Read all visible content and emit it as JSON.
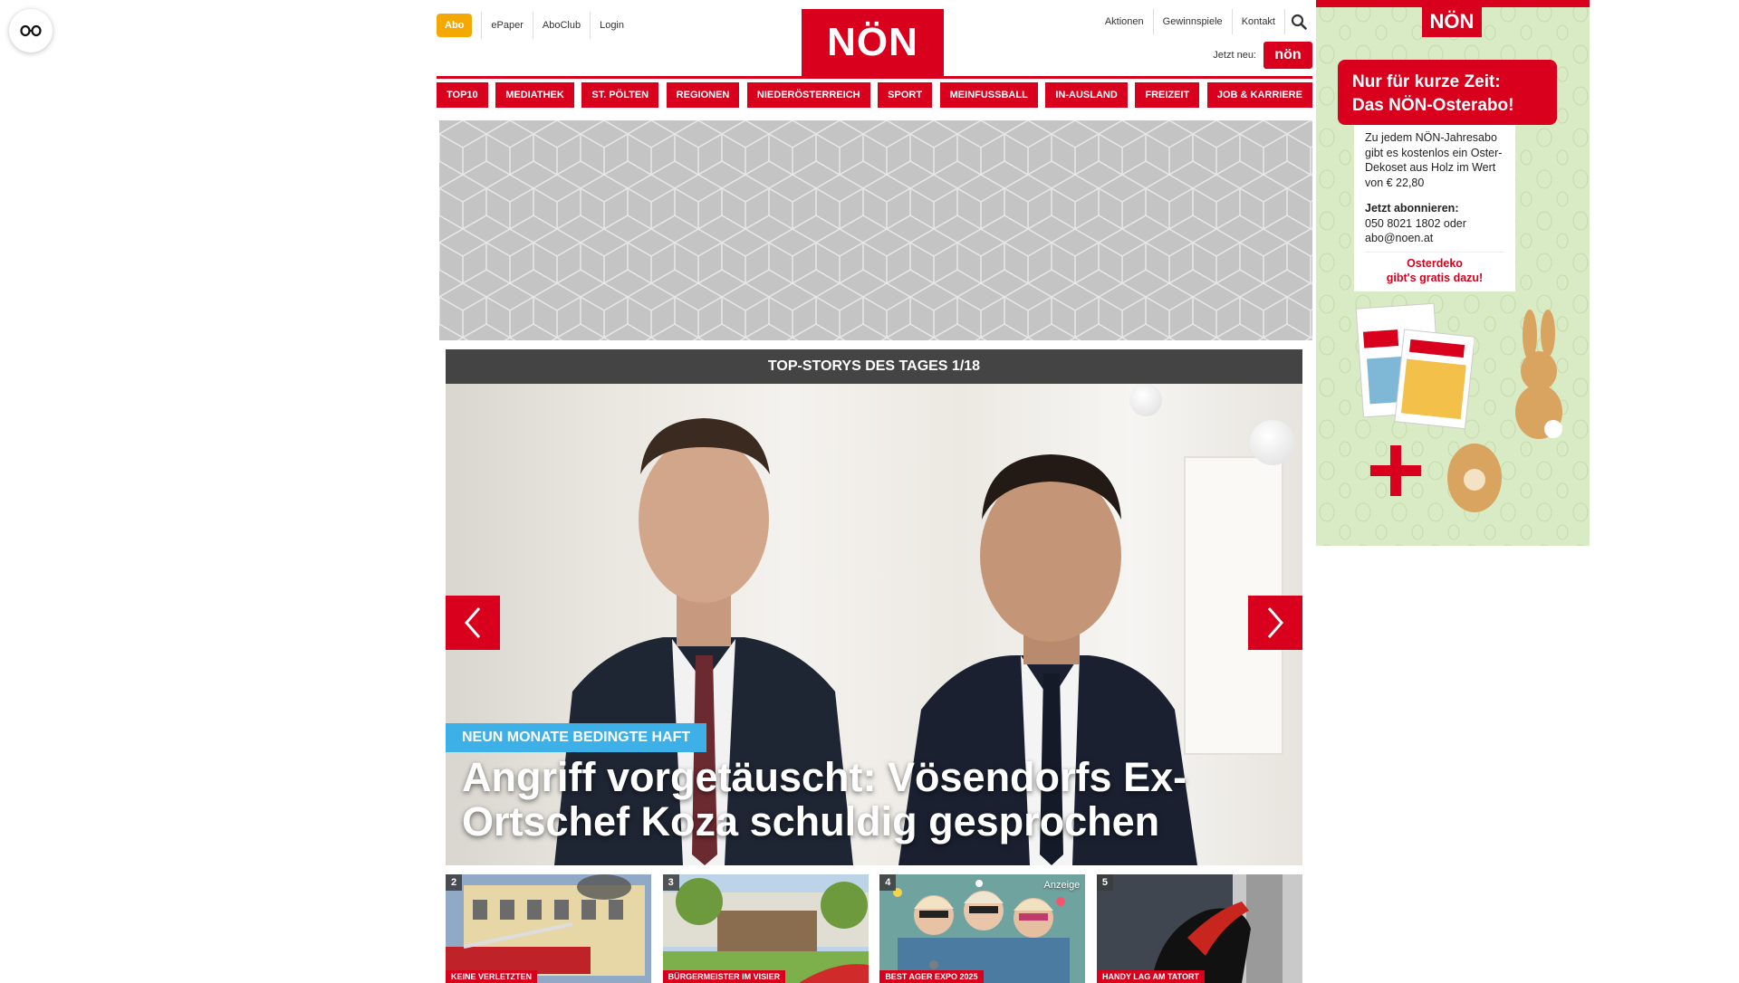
{
  "accessibility": {
    "icon": "glasses-icon"
  },
  "header": {
    "abo_label": "Abo",
    "left_links": [
      "ePaper",
      "AboClub",
      "Login"
    ],
    "logo_text": "NÖN",
    "right_links": [
      "Aktionen",
      "Gewinnspiele",
      "Kontakt"
    ],
    "search_icon": "search-icon",
    "jetzt_label": "Jetzt neu:",
    "jetzt_logo_text": "nön"
  },
  "nav": {
    "items": [
      "TOP10",
      "MEDIATHEK",
      "ST. PÖLTEN",
      "REGIONEN",
      "NIEDERÖSTERREICH",
      "SPORT",
      "MEINFUSSBALL",
      "IN-AUSLAND",
      "FREIZEIT",
      "JOB & KARRIERE"
    ]
  },
  "stories": {
    "heading": "TOP-STORYS DES TAGES 1/18",
    "hero": {
      "badge": "NEUN MONATE BEDINGTE HAFT",
      "title": "Angriff vorgetäuscht: Vösendorfs Ex-Ortschef Koza schuldig gesprochen"
    },
    "thumbs": [
      {
        "num": "2",
        "category": "KEINE VERLETZTEN",
        "ad": ""
      },
      {
        "num": "3",
        "category": "BÜRGERMEISTER IM VISIER",
        "ad": ""
      },
      {
        "num": "4",
        "category": "BEST AGER EXPO 2025",
        "ad": "Anzeige"
      },
      {
        "num": "5",
        "category": "HANDY LAG AM TATORT",
        "ad": ""
      }
    ]
  },
  "sidebar_ad": {
    "logo_text": "NÖN",
    "headline_1": "Nur für kurze Zeit:",
    "headline_2": "Das NÖN-Osterabo!",
    "body": "Zu jedem NÖN-Jahresabo gibt es kostenlos ein Oster-Dekoset aus Holz im Wert von € 22,80",
    "cta_label": "Jetzt abonnieren:",
    "cta_contact": "050 8021 1802 oder abo@noen.at",
    "highlight_1": "Osterdeko",
    "highlight_2": "gibt's gratis dazu!"
  },
  "colors": {
    "brand_red": "#d8001c",
    "abo_orange": "#f5a800",
    "badge_blue": "#3db0e8"
  }
}
